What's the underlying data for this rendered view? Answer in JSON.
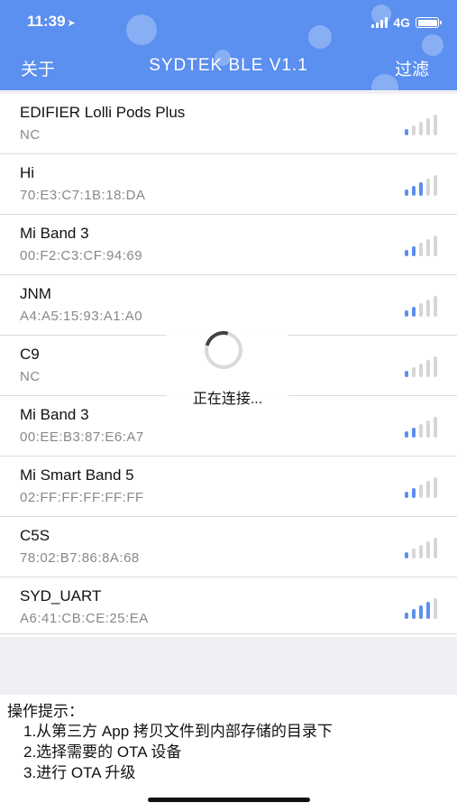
{
  "status_bar": {
    "time": "11:39",
    "network": "4G"
  },
  "nav": {
    "left": "关于",
    "title": "SYDTEK BLE V1.1",
    "right": "过滤"
  },
  "devices": [
    {
      "name": "EDIFIER Lolli Pods Plus",
      "address": "NC",
      "signal": 1
    },
    {
      "name": "Hi",
      "address": "70:E3:C7:1B:18:DA",
      "signal": 3
    },
    {
      "name": "Mi Band 3",
      "address": "00:F2:C3:CF:94:69",
      "signal": 2
    },
    {
      "name": "JNM",
      "address": "A4:A5:15:93:A1:A0",
      "signal": 2
    },
    {
      "name": "C9",
      "address": "NC",
      "signal": 1
    },
    {
      "name": "Mi Band 3",
      "address": "00:EE:B3:87:E6:A7",
      "signal": 2
    },
    {
      "name": "Mi Smart Band 5",
      "address": "02:FF:FF:FF:FF:FF",
      "signal": 2
    },
    {
      "name": "C5S",
      "address": "78:02:B7:86:8A:68",
      "signal": 1
    },
    {
      "name": "SYD_UART",
      "address": "A6:41:CB:CE:25:EA",
      "signal": 4
    }
  ],
  "loading": {
    "text": "正在连接..."
  },
  "tips": {
    "title": "操作提示：",
    "lines": [
      "1.从第三方 App 拷贝文件到内部存储的目录下",
      "2.选择需要的 OTA 设备",
      "3.进行 OTA 升级"
    ]
  },
  "colors": {
    "accent": "#5b8ff0",
    "signal_active": "#5b8ff0",
    "signal_inactive": "#d6d6da"
  }
}
